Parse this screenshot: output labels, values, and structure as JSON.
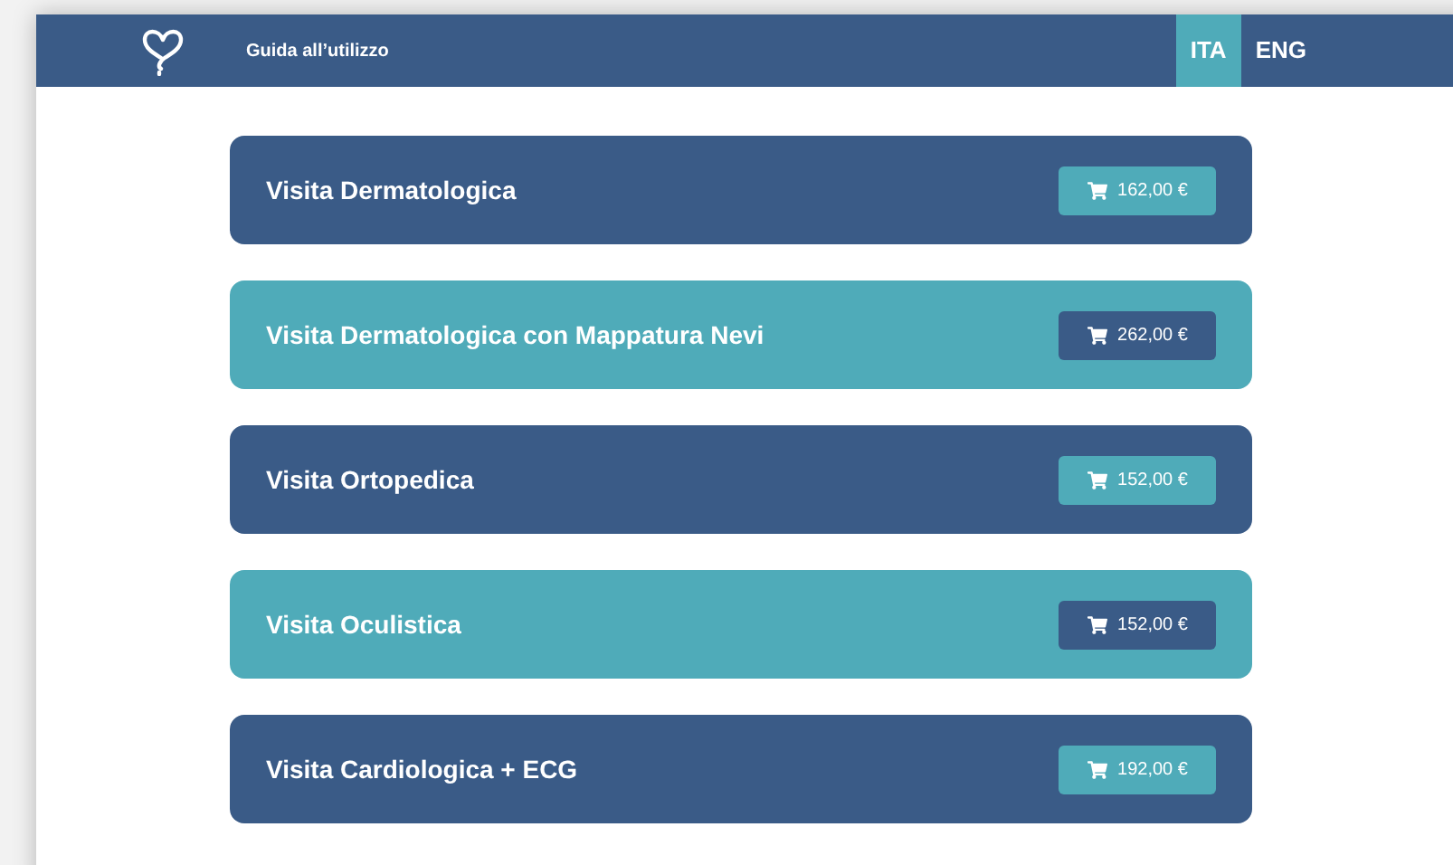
{
  "header": {
    "nav_link": "Guida all’utilizzo",
    "languages": [
      {
        "label": "ITA",
        "selected": true
      },
      {
        "label": "ENG",
        "selected": false
      }
    ]
  },
  "services": [
    {
      "name": "Visita Dermatologica",
      "price": "162,00 €",
      "color": "#3a5b87"
    },
    {
      "name": "Visita Dermatologica con Mappatura Nevi",
      "price": "262,00 €",
      "color": "#4fabb9"
    },
    {
      "name": "Visita Ortopedica",
      "price": "152,00 €",
      "color": "#3a5b87"
    },
    {
      "name": "Visita Oculistica",
      "price": "152,00 €",
      "color": "#4fabb9"
    },
    {
      "name": "Visita Cardiologica + ECG",
      "price": "192,00 €",
      "color": "#3a5b87"
    }
  ]
}
